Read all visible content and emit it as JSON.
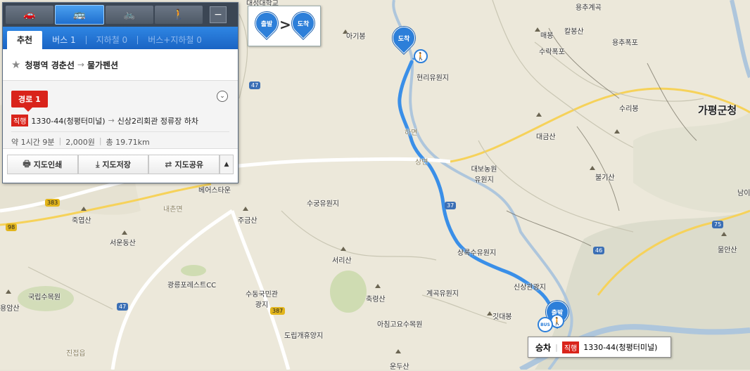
{
  "transport_modes": [
    {
      "icon": "car-icon",
      "glyph": "🚗"
    },
    {
      "icon": "bus-icon",
      "glyph": "🚌"
    },
    {
      "icon": "bicycle-icon",
      "glyph": "🚲"
    },
    {
      "icon": "walk-icon",
      "glyph": "🚶"
    }
  ],
  "minimize_label": "−",
  "tabs": [
    {
      "label": "추천"
    },
    {
      "label": "버스 1"
    },
    {
      "label": "지하철 0"
    },
    {
      "label": "버스+지하철 0"
    }
  ],
  "route": {
    "from": "청평역 경춘선",
    "arrow": "→",
    "to": "물가펜션"
  },
  "route_option": {
    "badge": "경로 1",
    "expand_icon": "⌄",
    "bus_type": "직행",
    "bus_number": "1330-44(청평터미널)",
    "step_arrow": "→",
    "alight": "신상2리회관 정류장 하차",
    "duration": "약 1시간 9분",
    "fare": "2,000원",
    "distance": "총 19.71km"
  },
  "actions": {
    "print": "지도인쇄",
    "save": "지도저장",
    "share": "지도공유",
    "up": "▲"
  },
  "legend": {
    "start": "출발",
    "end": "도착",
    "arrow": ">"
  },
  "map_pins": {
    "start": "출발",
    "end": "도착",
    "bus_stop": "BUS"
  },
  "boarding": {
    "label": "승차",
    "type": "직행",
    "bus": "1330-44(청평터미널)"
  },
  "map_labels": [
    "대성대학교",
    "아기봉",
    "용추계곡",
    "매봉",
    "칼봉산",
    "용추폭포",
    "수락폭포",
    "현리유원지",
    "가평군청",
    "수리봉",
    "대금산",
    "하면",
    "상면",
    "대보농원유원지",
    "불기산",
    "베어스타운",
    "내촌면",
    "죽엽산",
    "주금산",
    "수궁유원지",
    "서운동산",
    "상록수유원지",
    "서리산",
    "광릉포레스트CC",
    "국립수목원",
    "용암산",
    "수동국민관광지",
    "축령산",
    "계곡유원지",
    "신상관광지",
    "깃대봉",
    "아침고요수목원",
    "도립개휴양지",
    "진접읍",
    "운두산",
    "물안산",
    "남이"
  ],
  "road_numbers": [
    "47",
    "383",
    "98",
    "37",
    "46",
    "75",
    "387",
    "47"
  ]
}
